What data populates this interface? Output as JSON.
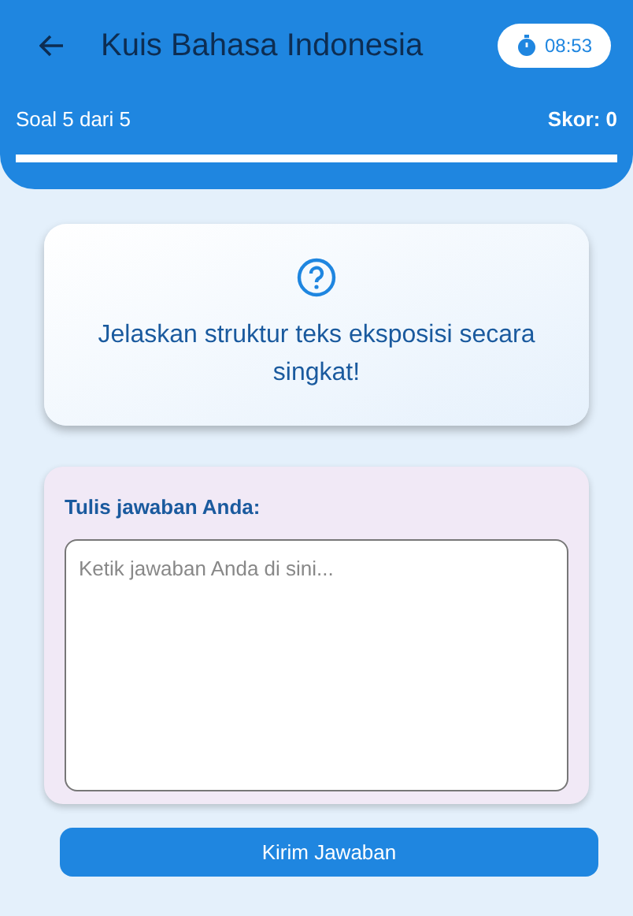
{
  "app_bar": {
    "title": "Kuis Bahasa Indonesia",
    "timer": "08:53"
  },
  "progress": {
    "question_label": "Soal 5 dari 5",
    "score_label": "Skor: 0"
  },
  "question": {
    "text": "Jelaskan struktur teks eksposisi secara singkat!"
  },
  "answer": {
    "label": "Tulis jawaban Anda:",
    "placeholder": "Ketik jawaban Anda di sini..."
  },
  "submit_button": "Kirim Jawaban"
}
